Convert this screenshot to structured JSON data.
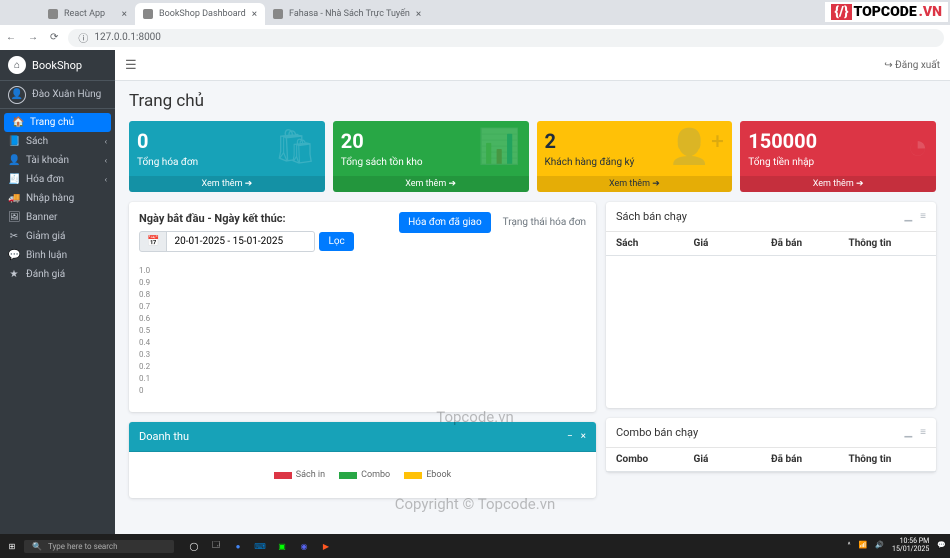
{
  "browser": {
    "tabs": [
      {
        "title": "React App",
        "active": false
      },
      {
        "title": "BookShop Dashboard",
        "active": true
      },
      {
        "title": "Fahasa - Nhà Sách Trực Tuyến",
        "active": false
      }
    ],
    "url": "127.0.0.1:8000",
    "windowControls": {
      "minimize": "—",
      "maximize": "▢",
      "close": "✕"
    }
  },
  "topLogo": {
    "braces": "{/}",
    "main": "TOPCODE",
    "suffix": ".VN"
  },
  "sidebar": {
    "brand": "BookShop",
    "user": "Đào Xuân Hùng",
    "items": [
      {
        "icon": "🏠",
        "label": "Trang chủ",
        "active": true
      },
      {
        "icon": "📘",
        "label": "Sách",
        "caret": true
      },
      {
        "icon": "👤",
        "label": "Tài khoản",
        "caret": true
      },
      {
        "icon": "🧾",
        "label": "Hóa đơn",
        "caret": true
      },
      {
        "icon": "🚚",
        "label": "Nhập hàng"
      },
      {
        "icon": "🖼",
        "label": "Banner"
      },
      {
        "icon": "✂",
        "label": "Giảm giá"
      },
      {
        "icon": "💬",
        "label": "Bình luận"
      },
      {
        "icon": "★",
        "label": "Đánh giá"
      }
    ]
  },
  "topbar": {
    "hamburger": "☰",
    "logout": "↪ Đăng xuất"
  },
  "page": {
    "title": "Trang chủ"
  },
  "stats": [
    {
      "color": "blue",
      "value": "0",
      "label": "Tổng hóa đơn",
      "icon": "🛍",
      "footer": "Xem thêm ➔"
    },
    {
      "color": "green",
      "value": "20",
      "label": "Tổng sách tồn kho",
      "icon": "📊",
      "footer": "Xem thêm ➔"
    },
    {
      "color": "yellow",
      "value": "2",
      "label": "Khách hàng đăng ký",
      "icon": "👤⁺",
      "footer": "Xem thêm ➔"
    },
    {
      "color": "red",
      "value": "150000",
      "label": "Tổng tiền nhập",
      "icon": "◔",
      "footer": "Xem thêm ➔"
    }
  ],
  "filter": {
    "label": "Ngày bắt đầu - Ngày kết thúc:",
    "calendarIcon": "📅",
    "dateRange": "20-01-2025 - 15-01-2025",
    "button": "Lọc",
    "link1": "Hóa đơn đã giao",
    "link2": "Trạng thái hóa đơn"
  },
  "chart_data": {
    "type": "bar",
    "title": "",
    "y_ticks": [
      "1.0",
      "0.9",
      "0.8",
      "0.7",
      "0.6",
      "0.5",
      "0.4",
      "0.3",
      "0.2",
      "0.1",
      "0"
    ],
    "ylim": [
      0,
      1.0
    ],
    "categories": [],
    "series": []
  },
  "revenue": {
    "title": "Doanh thu",
    "legend": [
      {
        "color": "#dc3545",
        "label": "Sách in"
      },
      {
        "color": "#28a745",
        "label": "Combo"
      },
      {
        "color": "#ffc107",
        "label": "Ebook"
      }
    ]
  },
  "bestBooks": {
    "title": "Sách bán chạy",
    "columns": [
      "Sách",
      "Giá",
      "Đã bán",
      "Thông tin"
    ]
  },
  "bestCombos": {
    "title": "Combo bán chạy",
    "columns": [
      "Combo",
      "Giá",
      "Đã bán",
      "Thông tin"
    ]
  },
  "watermarks": {
    "wm1": "Topcode.vn",
    "wm2": "Copyright © Topcode.vn"
  },
  "taskbar": {
    "search": "Type here to search",
    "time": "10:56 PM",
    "date": "15/01/2025"
  }
}
